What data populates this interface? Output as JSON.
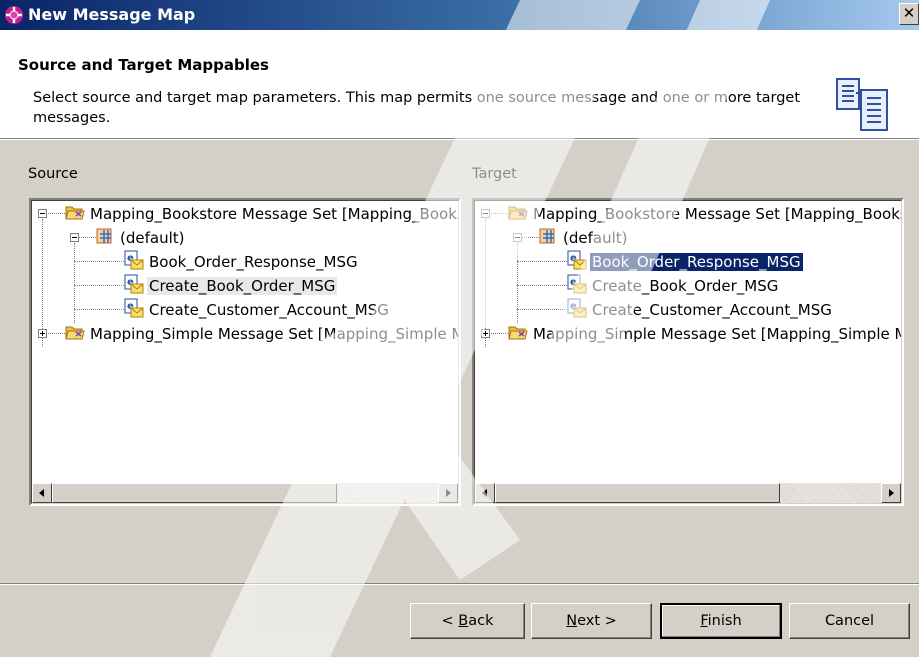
{
  "window": {
    "title": "New Message Map",
    "close_glyph": "✕"
  },
  "header": {
    "title": "Source and Target Mappables",
    "description": "Select source and target map parameters. This map permits one source message and one or more target messages."
  },
  "source": {
    "label": "Source",
    "tree": {
      "message_set_1": "Mapping_Bookstore Message Set [Mapping_Bookstore]",
      "default_node": "(default)",
      "messages": [
        "Book_Order_Response_MSG",
        "Create_Book_Order_MSG",
        "Create_Customer_Account_MSG"
      ],
      "message_set_2": "Mapping_Simple Message Set [Mapping_Simple Message Set]"
    },
    "selected": "Create_Book_Order_MSG"
  },
  "target": {
    "label": "Target",
    "tree": {
      "message_set_1": "Mapping_Bookstore Message Set [Mapping_Bookstore]",
      "default_node": "(default)",
      "messages": [
        "Book_Order_Response_MSG",
        "Create_Book_Order_MSG",
        "Create_Customer_Account_MSG"
      ],
      "message_set_2": "Mapping_Simple Message Set [Mapping_Simple Message Set]"
    },
    "selected": "Book_Order_Response_MSG"
  },
  "buttons": {
    "back": {
      "prefix": "< ",
      "mnemonic": "B",
      "rest": "ack"
    },
    "next": {
      "mnemonic": "N",
      "rest": "ext >"
    },
    "finish": {
      "mnemonic": "F",
      "rest": "inish"
    },
    "cancel": "Cancel"
  },
  "colors": {
    "title_bar": "#0a246a",
    "selection": "#0a246a",
    "dialog_bg": "#d4d0c8"
  },
  "icons": {
    "title": "message-map-icon",
    "wizard": "document-icon",
    "message_set": "folder-icon",
    "default": "package-icon",
    "message": "message-icon"
  }
}
